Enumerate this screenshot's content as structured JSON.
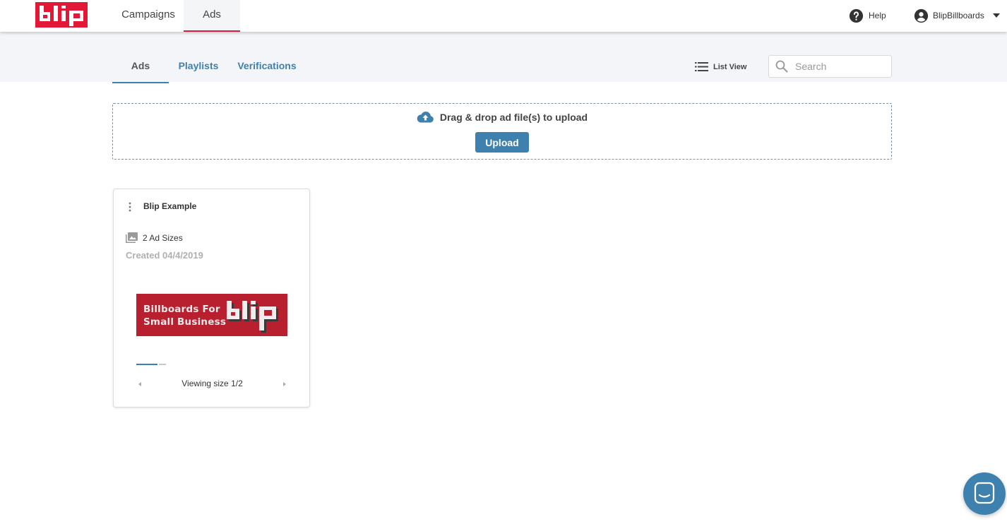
{
  "brand": {
    "logo_text": "blip",
    "accent": "#e31837",
    "link_color": "#3e81ae"
  },
  "topnav": {
    "tabs": [
      {
        "label": "Campaigns"
      },
      {
        "label": "Ads",
        "active": true
      }
    ],
    "help_label": "Help",
    "user_name": "BlipBillboards"
  },
  "subnav": {
    "tabs": [
      {
        "label": "Ads",
        "active": true
      },
      {
        "label": "Playlists"
      },
      {
        "label": "Verifications"
      }
    ],
    "list_view_label": "List View",
    "search_placeholder": "Search"
  },
  "upload": {
    "drop_text": "Drag & drop ad file(s) to upload",
    "button_label": "Upload"
  },
  "cards": [
    {
      "title": "Blip Example",
      "ad_sizes": "2 Ad Sizes",
      "created": "Created 04/4/2019",
      "preview_text_line1": "Billboards For",
      "preview_text_line2": "Small Business",
      "viewing": "Viewing size 1/2"
    }
  ],
  "icons": {
    "help": "help-circle-icon",
    "user": "account-circle-icon",
    "dropdown": "caret-down-icon",
    "list": "list-icon",
    "search": "search-icon",
    "upload": "cloud-upload-icon",
    "menu": "more-vertical-icon",
    "image": "image-stack-icon",
    "chat": "chat-icon"
  }
}
